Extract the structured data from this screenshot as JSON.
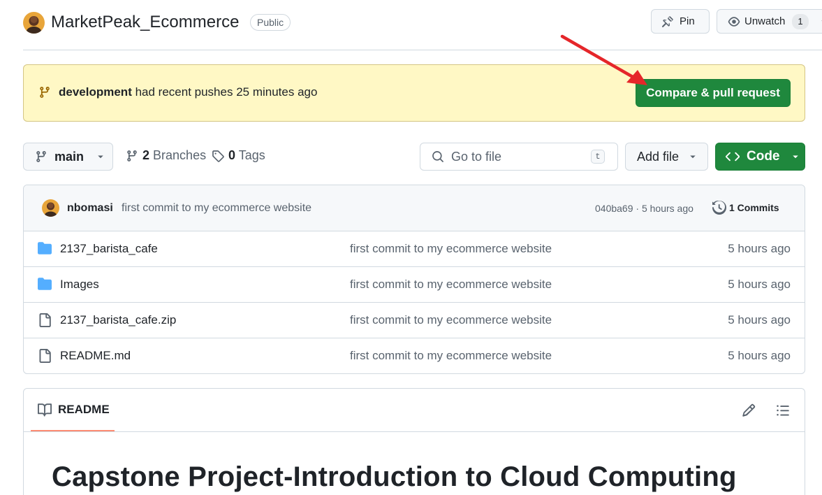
{
  "header": {
    "repo_name": "MarketPeak_Ecommerce",
    "visibility": "Public",
    "pin_label": "Pin",
    "unwatch_label": "Unwatch",
    "watch_count": "1"
  },
  "banner": {
    "branch": "development",
    "message": "had recent pushes 25 minutes ago",
    "compare_label": "Compare & pull request"
  },
  "toolbar": {
    "branch": "main",
    "branches_count": "2",
    "branches_label": "Branches",
    "tags_count": "0",
    "tags_label": "Tags",
    "search_placeholder": "Go to file",
    "search_shortcut": "t",
    "add_file_label": "Add file",
    "code_label": "Code"
  },
  "latest_commit": {
    "author": "nbomasi",
    "message": "first commit to my ecommerce website",
    "meta": "040ba69 · 5 hours ago",
    "commits_label": "1 Commits"
  },
  "files": [
    {
      "name": "2137_barista_cafe",
      "type": "folder",
      "commit": "first commit to my ecommerce website",
      "time": "5 hours ago"
    },
    {
      "name": "Images",
      "type": "folder",
      "commit": "first commit to my ecommerce website",
      "time": "5 hours ago"
    },
    {
      "name": "2137_barista_cafe.zip",
      "type": "file",
      "commit": "first commit to my ecommerce website",
      "time": "5 hours ago"
    },
    {
      "name": "README.md",
      "type": "file",
      "commit": "first commit to my ecommerce website",
      "time": "5 hours ago"
    }
  ],
  "readme": {
    "tab_label": "README",
    "title": "Capstone Project-Introduction to Cloud Computing"
  },
  "colors": {
    "primary_green": "#1f883d",
    "banner_yellow": "#fff8c5",
    "folder_blue": "#54aeff",
    "annotation_red": "#e5262a"
  },
  "icons": {
    "pin": "pin-icon",
    "eye": "eye-icon",
    "branch": "git-branch-icon",
    "tag": "tag-icon",
    "search": "search-icon",
    "code": "code-icon",
    "history": "history-icon",
    "folder": "folder-icon",
    "file": "file-icon",
    "book": "book-icon",
    "pencil": "pencil-icon",
    "list": "list-icon"
  }
}
